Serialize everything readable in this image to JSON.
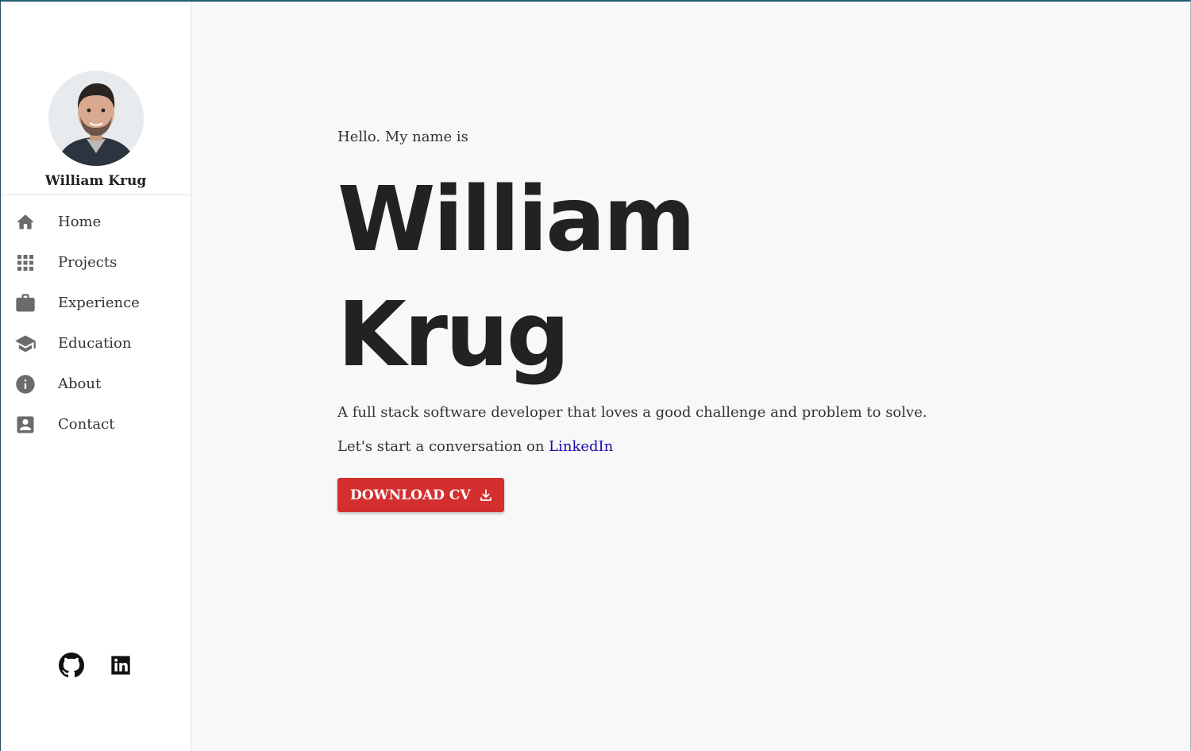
{
  "profile": {
    "name": "William Krug"
  },
  "nav": {
    "items": [
      {
        "label": "Home",
        "icon": "home-icon"
      },
      {
        "label": "Projects",
        "icon": "apps-grid-icon"
      },
      {
        "label": "Experience",
        "icon": "briefcase-icon"
      },
      {
        "label": "Education",
        "icon": "graduation-cap-icon"
      },
      {
        "label": "About",
        "icon": "info-icon"
      },
      {
        "label": "Contact",
        "icon": "contact-card-icon"
      }
    ]
  },
  "social": {
    "github": "github-icon",
    "linkedin": "linkedin-icon"
  },
  "hero": {
    "greeting": "Hello. My name is",
    "first_name": "William",
    "last_name": "Krug",
    "tagline": "A full stack software developer that loves a good challenge and problem to solve.",
    "cta_prefix": "Let's start a conversation on",
    "cta_link": "LinkedIn",
    "download_label": "DOWNLOAD CV"
  },
  "colors": {
    "accent_button": "#d32f2f",
    "link": "#1a0dab",
    "icon_gray": "#6b6b6b"
  }
}
